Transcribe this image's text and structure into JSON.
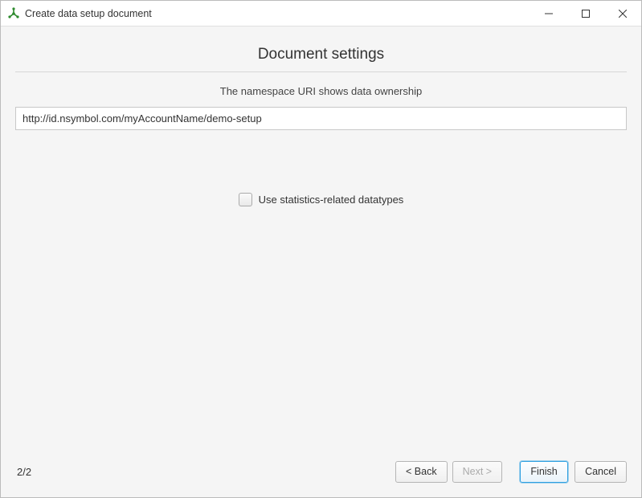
{
  "window": {
    "title": "Create data setup document"
  },
  "main": {
    "heading": "Document settings",
    "subheading": "The namespace URI shows data ownership",
    "uri_value": "http://id.nsymbol.com/myAccountName/demo-setup",
    "checkbox_label": "Use statistics-related datatypes"
  },
  "footer": {
    "page": "2/2",
    "back": "< Back",
    "next": "Next >",
    "finish": "Finish",
    "cancel": "Cancel"
  }
}
